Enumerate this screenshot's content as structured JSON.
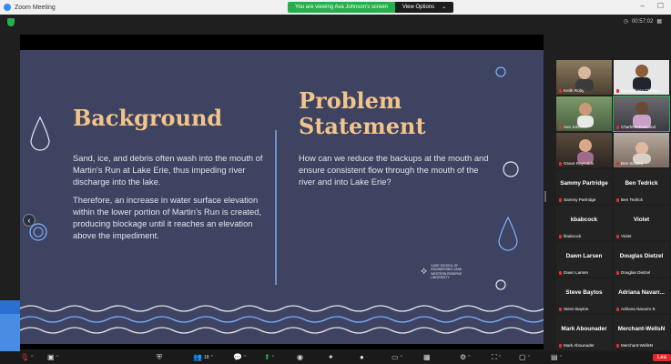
{
  "app": {
    "title": "Zoom Meeting"
  },
  "banner": {
    "message": "You are viewing Ava Johnson's screen",
    "view_options": "View Options",
    "caret": "⌄"
  },
  "timer": {
    "value": "00:57:02"
  },
  "slide": {
    "background_title": "Background",
    "problem_title": "Problem Statement",
    "background_para1": "Sand, ice, and debris often wash into the mouth of Martin's Run at Lake Erie, thus impeding river discharge into the lake.",
    "background_para2": "Therefore, an increase in water surface elevation within the lower portion of Martin's Run is created, producing blockage until it reaches an elevation above the impediment.",
    "problem_para": "How can we  reduce the backups at the mouth and ensure consistent flow through the mouth of the river and into Lake Erie?",
    "logo_text": "CASE SCHOOL OF ENGINEERING CASE WESTERN RESERVE UNIVERSITY",
    "colors": {
      "background": "#3d4360",
      "title": "#f2c48b",
      "accent": "#6d8fc9"
    }
  },
  "gallery": {
    "video_tiles": [
      {
        "name": "Keith Roby"
      },
      {
        "name": "Muralidhasa Chelup..."
      },
      {
        "name": "Ava Johnson"
      },
      {
        "name": "Charlene Kusnand"
      },
      {
        "name": "Grace Reynolds"
      },
      {
        "name": "Ben Kinsley"
      }
    ],
    "name_tiles": [
      {
        "display": "Sammy Partridge",
        "label": "Sammy Partridge"
      },
      {
        "display": "Ben Tedrick",
        "label": "Ben Tedrick"
      },
      {
        "display": "kbabcock",
        "label": "kbabcock"
      },
      {
        "display": "Violet",
        "label": "Violet"
      },
      {
        "display": "Dawn Larsen",
        "label": "Dawn Larsen"
      },
      {
        "display": "Douglas Dietzel",
        "label": "Douglas Dietzel"
      },
      {
        "display": "Steve Baytos",
        "label": "Steve Baytos"
      },
      {
        "display": "Adriana  Navarr...",
        "label": "Adriana Navarro E"
      },
      {
        "display": "Mark Abounader",
        "label": "Mark Abounader"
      },
      {
        "display": "Merchant-WellsN",
        "label": "Merchant-WellsN"
      }
    ]
  },
  "toolbar": {
    "participants_count": "18",
    "leave_label": "Lea"
  }
}
